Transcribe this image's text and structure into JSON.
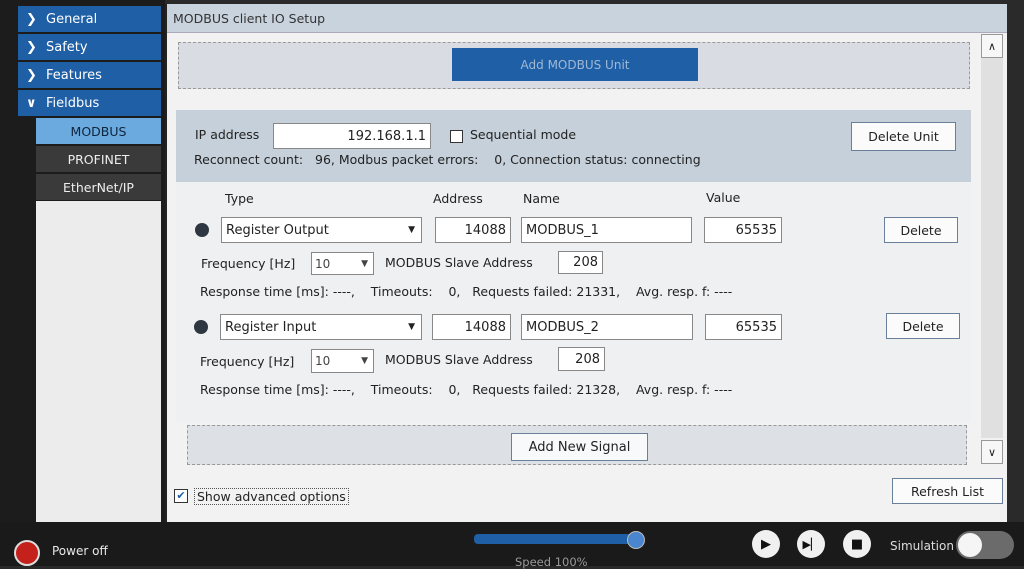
{
  "sidebar": {
    "items": [
      {
        "label": "General",
        "chevron": "chevron-right-icon"
      },
      {
        "label": "Safety",
        "chevron": "chevron-right-icon"
      },
      {
        "label": "Features",
        "chevron": "chevron-right-icon"
      },
      {
        "label": "Fieldbus",
        "chevron": "chevron-down-icon"
      }
    ],
    "subitems": [
      {
        "label": "MODBUS",
        "active": true
      },
      {
        "label": "PROFINET",
        "active": false
      },
      {
        "label": "EtherNet/IP",
        "active": false
      }
    ]
  },
  "window": {
    "title": "MODBUS client IO Setup"
  },
  "add_unit": {
    "label": "Add MODBUS Unit"
  },
  "unit": {
    "ip_label": "IP address",
    "ip_value": "192.168.1.1",
    "sequential_label": "Sequential mode",
    "sequential_checked": false,
    "delete_unit_label": "Delete Unit",
    "status_text": "Reconnect count:   96, Modbus packet errors:    0, Connection status: connecting"
  },
  "signal_headers": {
    "type": "Type",
    "address": "Address",
    "name": "Name",
    "value": "Value"
  },
  "signals": [
    {
      "type": "Register Output",
      "address": "14088",
      "name": "MODBUS_1",
      "value": "65535",
      "delete_label": "Delete",
      "frequency_label": "Frequency [Hz]",
      "frequency_value": "10",
      "slave_label": "MODBUS Slave Address",
      "slave_value": "208",
      "response_text": "Response time [ms]: ----,    Timeouts:    0,   Requests failed: 21331,    Avg. resp. f: ----"
    },
    {
      "type": "Register Input",
      "address": "14088",
      "name": "MODBUS_2",
      "value": "65535",
      "delete_label": "Delete",
      "frequency_label": "Frequency [Hz]",
      "frequency_value": "10",
      "slave_label": "MODBUS Slave Address",
      "slave_value": "208",
      "response_text": "Response time [ms]: ----,    Timeouts:    0,   Requests failed: 21328,    Avg. resp. f: ----"
    }
  ],
  "add_signal": {
    "label": "Add New Signal"
  },
  "advanced": {
    "label": "Show advanced options",
    "checked": true
  },
  "refresh": {
    "label": "Refresh List"
  },
  "bottom_bar": {
    "power_label": "Power off",
    "speed_label": "Speed 100%",
    "speed_percent": 100,
    "simulation_label": "Simulation",
    "simulation_on": false
  },
  "colors": {
    "accent": "#1f5fa6",
    "active_sub": "#6aaadf",
    "power": "#c4201c"
  }
}
